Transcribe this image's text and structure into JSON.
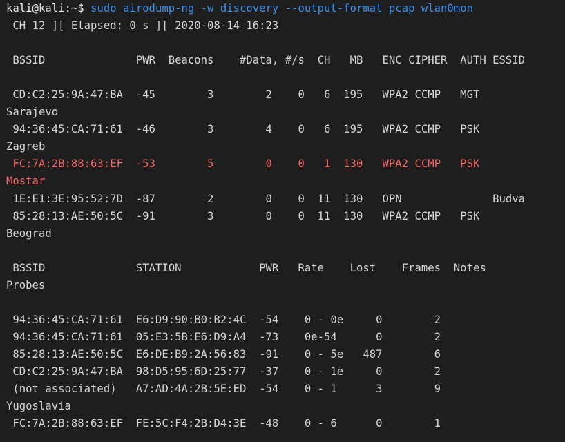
{
  "prompt": "kali@kali:~$",
  "command": "sudo airodump-ng -w discovery --output-format pcap wlan0mon",
  "status_line": " CH 12 ][ Elapsed: 0 s ][ 2020-08-14 16:23",
  "ap_header": " BSSID              PWR  Beacons    #Data, #/s  CH   MB   ENC CIPHER  AUTH ESSID",
  "ap_rows": [
    {
      "line": " CD:C2:25:9A:47:BA  -45        3        2    0   6  195   WPA2 CCMP   MGT",
      "essid": "Sarajevo"
    },
    {
      "line": " 94:36:45:CA:71:61  -46        3        4    0   6  195   WPA2 CCMP   PSK",
      "essid": "Zagreb"
    },
    {
      "line": " FC:7A:2B:88:63:EF  -53        5        0    0   1  130   WPA2 CCMP   PSK",
      "essid": "Mostar"
    },
    {
      "line": " 1E:E1:3E:95:52:7D  -87        2        0    0  11  130   OPN              Budva",
      "essid": ""
    },
    {
      "line": " 85:28:13:AE:50:5C  -91        3        0    0  11  130   WPA2 CCMP   PSK",
      "essid": "Beograd"
    }
  ],
  "station_header": " BSSID              STATION            PWR   Rate    Lost    Frames  Notes",
  "station_header_wrap": "Probes",
  "station_rows": [
    {
      "line": " 94:36:45:CA:71:61  E6:D9:90:B0:B2:4C  -54    0 - 0e     0        2",
      "probe": ""
    },
    {
      "line": " 94:36:45:CA:71:61  05:E3:5B:E6:D9:A4  -73    0e-54      0        2",
      "probe": ""
    },
    {
      "line": " 85:28:13:AE:50:5C  E6:DE:B9:2A:56:83  -91    0 - 5e   487        6",
      "probe": ""
    },
    {
      "line": " CD:C2:25:9A:47:BA  98:D5:95:6D:25:77  -37    0 - 1e     0        2",
      "probe": ""
    },
    {
      "line": " (not associated)   A7:AD:4A:2B:5E:ED  -54    0 - 1      3        9",
      "probe": "Yugoslavia"
    },
    {
      "line": " FC:7A:2B:88:63:EF  FE:5C:F4:2B:D4:3E  -48    0 - 6      0        1",
      "probe": ""
    }
  ],
  "colors": {
    "background": "#1e1e1e",
    "text": "#d4d4d4",
    "command": "#3b8eea",
    "highlight": "#f06464"
  }
}
